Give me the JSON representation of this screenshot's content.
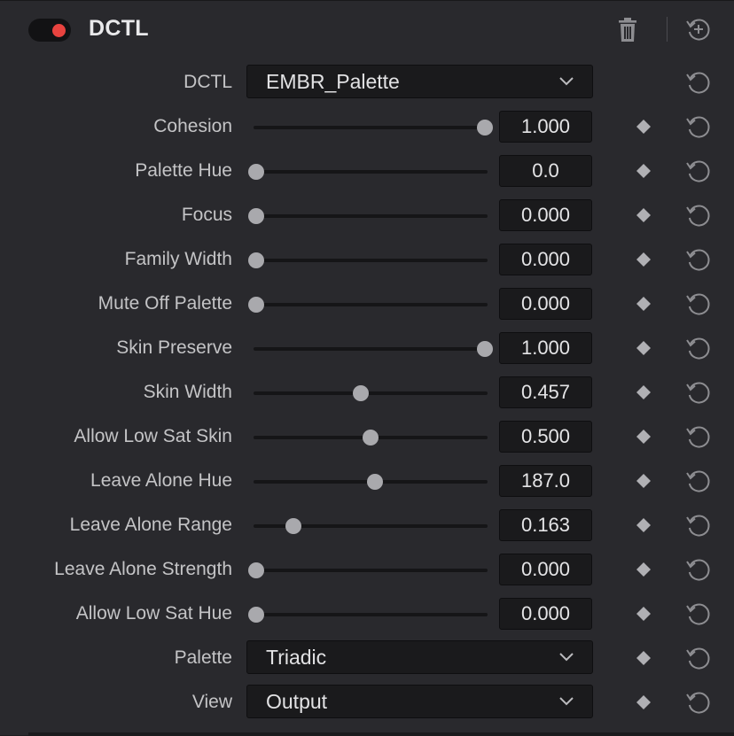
{
  "header": {
    "enabled": true,
    "title": "DCTL"
  },
  "rows": [
    {
      "type": "dropdown",
      "label": "DCTL",
      "value": "EMBR_Palette",
      "keyframe": false
    },
    {
      "type": "slider",
      "label": "Cohesion",
      "value": "1.000",
      "position": 1.0
    },
    {
      "type": "slider",
      "label": "Palette Hue",
      "value": "0.0",
      "position": 0.0
    },
    {
      "type": "slider",
      "label": "Focus",
      "value": "0.000",
      "position": 0.0
    },
    {
      "type": "slider",
      "label": "Family Width",
      "value": "0.000",
      "position": 0.0
    },
    {
      "type": "slider",
      "label": "Mute Off Palette",
      "value": "0.000",
      "position": 0.0
    },
    {
      "type": "slider",
      "label": "Skin Preserve",
      "value": "1.000",
      "position": 1.0
    },
    {
      "type": "slider",
      "label": "Skin Width",
      "value": "0.457",
      "position": 0.457
    },
    {
      "type": "slider",
      "label": "Allow Low Sat Skin",
      "value": "0.500",
      "position": 0.5
    },
    {
      "type": "slider",
      "label": "Leave Alone Hue",
      "value": "187.0",
      "position": 0.52
    },
    {
      "type": "slider",
      "label": "Leave Alone Range",
      "value": "0.163",
      "position": 0.163
    },
    {
      "type": "slider",
      "label": "Leave Alone Strength",
      "value": "0.000",
      "position": 0.0
    },
    {
      "type": "slider",
      "label": "Allow Low Sat Hue",
      "value": "0.000",
      "position": 0.0
    },
    {
      "type": "dropdown",
      "label": "Palette",
      "value": "Triadic",
      "keyframe": true
    },
    {
      "type": "dropdown",
      "label": "View",
      "value": "Output",
      "keyframe": true
    }
  ],
  "colors": {
    "panel_bg": "#29292d",
    "field_bg": "#1a1a1c",
    "toggle_on": "#e8433f",
    "thumb": "#a9a9ad"
  },
  "icons": {
    "toggle": "power-toggle",
    "delete": "trash-icon",
    "reset_all": "reset-all-icon",
    "keyframe": "diamond-icon",
    "reset": "reset-icon",
    "dropdown": "chevron-down-icon"
  }
}
